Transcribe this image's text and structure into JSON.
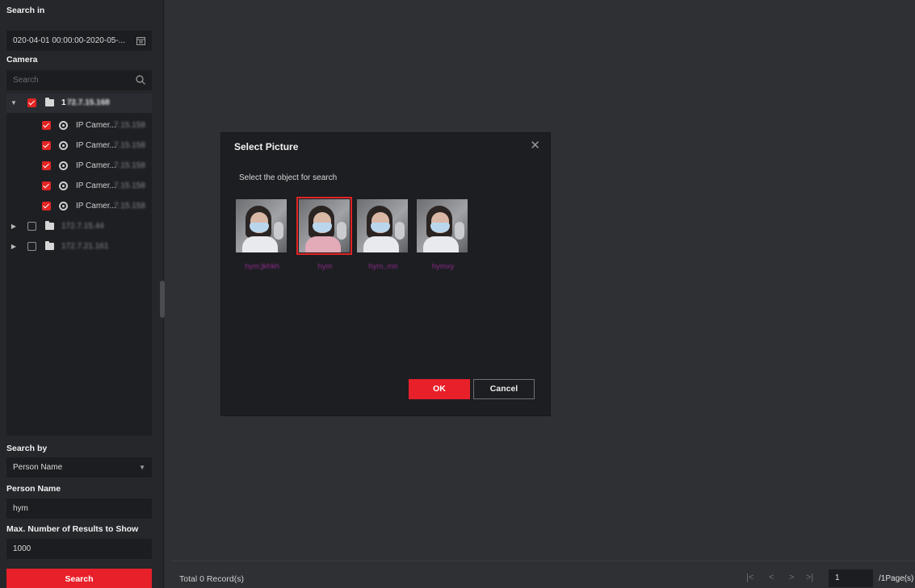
{
  "left": {
    "search_in_label": "Search in",
    "date_range": "020-04-01 00:00:00-2020-05-...",
    "camera_label": "Camera",
    "search_placeholder": "Search",
    "tree": {
      "root1": {
        "label": "1",
        "blurred": "72.7.15.168",
        "checked": true,
        "expanded": true
      },
      "cameras": [
        {
          "label": "IP Camer...",
          "blurred": "7.15.158",
          "checked": true
        },
        {
          "label": "IP Camer...",
          "blurred": "7.15.158",
          "checked": true
        },
        {
          "label": "IP Camer...",
          "blurred": "7.15.158",
          "checked": true
        },
        {
          "label": "IP Camer...",
          "blurred": "7.15.158",
          "checked": true
        },
        {
          "label": "IP Camer...",
          "blurred": "7.15.158",
          "checked": true
        }
      ],
      "root2": {
        "blurred": "172.7.15.44",
        "checked": false,
        "expanded": false
      },
      "root3": {
        "blurred": "172.7.21.161",
        "checked": false,
        "expanded": false
      }
    },
    "search_by_label": "Search by",
    "search_by_value": "Person Name",
    "person_name_label": "Person Name",
    "person_name_value": "hym",
    "max_results_label": "Max. Number of Results to Show",
    "max_results_value": "1000",
    "search_button": "Search"
  },
  "status_bar": {
    "total_records": "Total 0 Record(s)",
    "page_value": "1",
    "page_total": "/1Page(s)"
  },
  "dialog": {
    "title": "Select Picture",
    "subtitle": "Select the object for search",
    "thumbnails": [
      {
        "label": "hym;jkhkh",
        "selected": false
      },
      {
        "label": "hym",
        "selected": true
      },
      {
        "label": "hym,.mn",
        "selected": false
      },
      {
        "label": "hymxy",
        "selected": false
      }
    ],
    "ok_button": "OK",
    "cancel_button": "Cancel"
  },
  "colors": {
    "accent_red": "#e8202a",
    "panel_dark": "#25272b",
    "thumb_label_purple": "#8e2a8e"
  },
  "icons": [
    "calendar-icon",
    "search-icon",
    "chevron-down-icon",
    "folder-icon",
    "camera-icon",
    "close-icon",
    "first-page-icon",
    "prev-page-icon",
    "next-page-icon",
    "last-page-icon"
  ]
}
